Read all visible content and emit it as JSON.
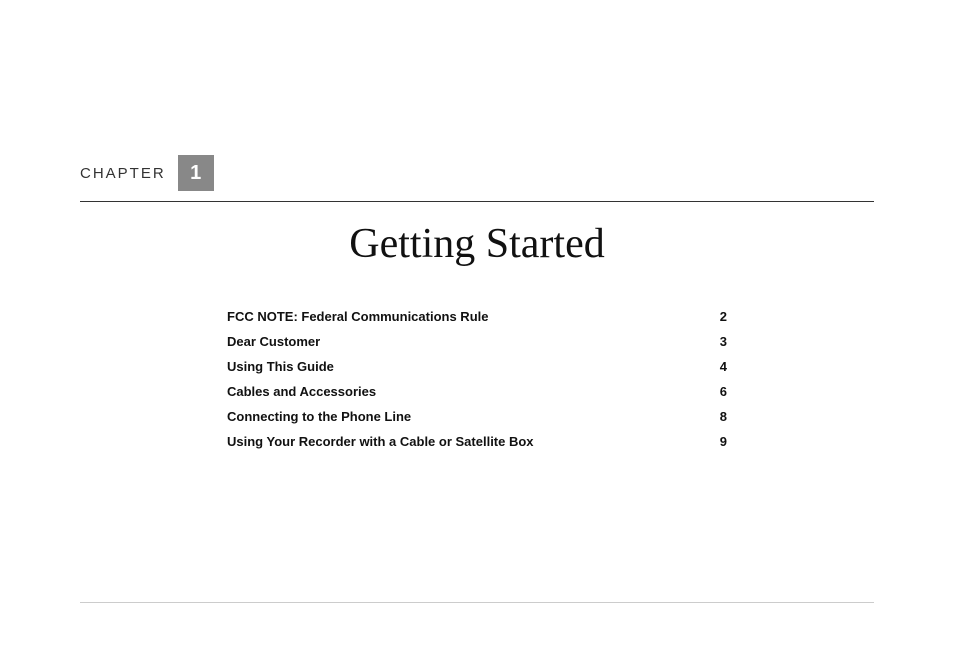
{
  "chapter": {
    "label": "Chapter",
    "number": "1",
    "title": "Getting Started"
  },
  "toc": {
    "entries": [
      {
        "title": "FCC NOTE: Federal Communications Rule",
        "page": "2"
      },
      {
        "title": "Dear Customer",
        "page": "3"
      },
      {
        "title": "Using This Guide",
        "page": "4"
      },
      {
        "title": "Cables and Accessories",
        "page": "6"
      },
      {
        "title": "Connecting to the Phone Line",
        "page": "8"
      },
      {
        "title": "Using Your Recorder with a Cable or Satellite Box",
        "page": "9"
      }
    ]
  }
}
